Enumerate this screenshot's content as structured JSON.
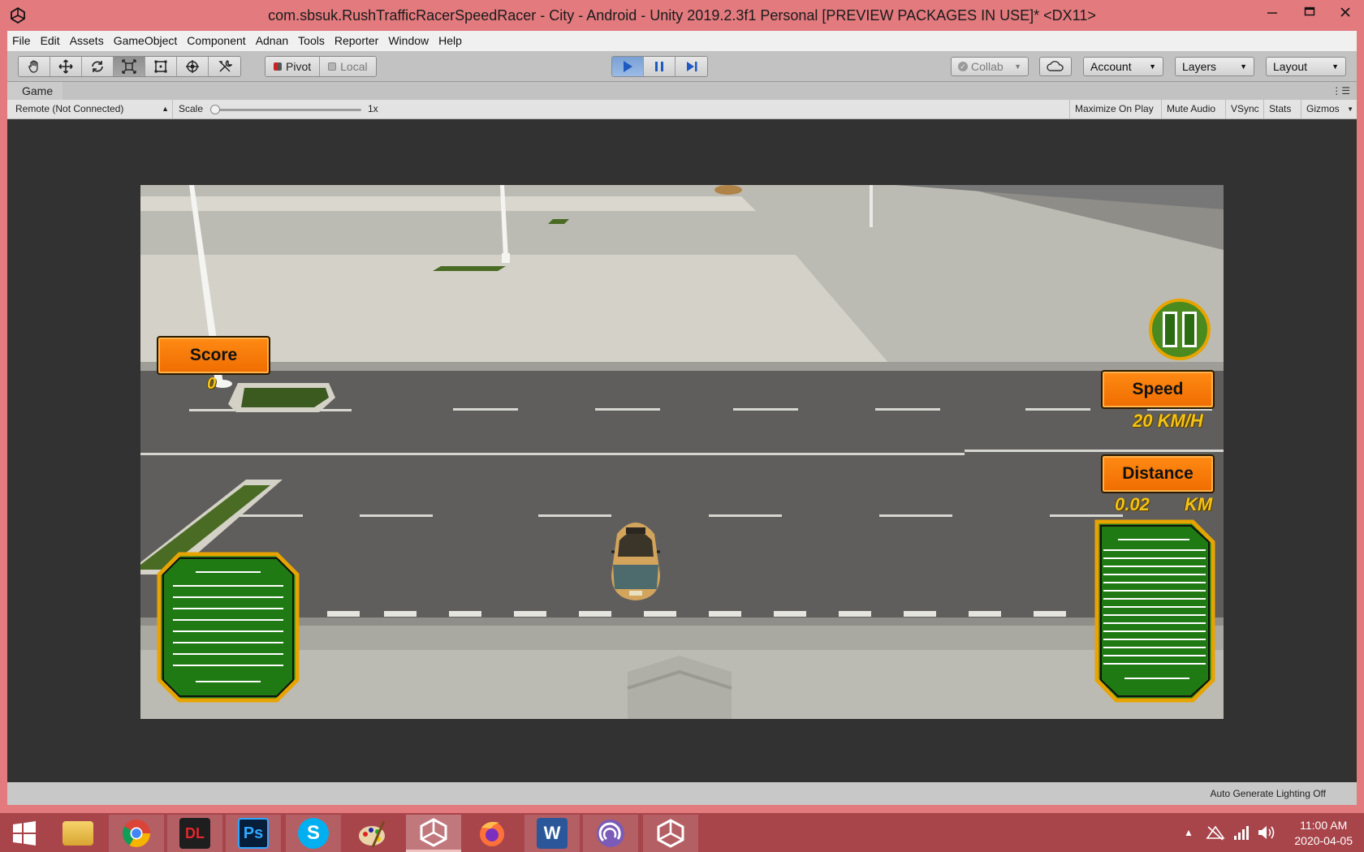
{
  "window": {
    "title": "com.sbsuk.RushTrafficRacerSpeedRacer - City - Android - Unity 2019.2.3f1 Personal [PREVIEW PACKAGES IN USE]* <DX11>",
    "controls": [
      "minimize-icon",
      "maximize-icon",
      "close-icon"
    ]
  },
  "menu": [
    "File",
    "Edit",
    "Assets",
    "GameObject",
    "Component",
    "Adnan",
    "Tools",
    "Reporter",
    "Window",
    "Help"
  ],
  "toolbar": {
    "transform_tools": [
      "hand-icon",
      "move-icon",
      "rotate-icon",
      "scale-icon",
      "rect-icon",
      "transform-icon",
      "custom-tool-icon"
    ],
    "pivot_label": "Pivot",
    "local_label": "Local",
    "collab_label": "Collab",
    "account_label": "Account",
    "layers_label": "Layers",
    "layout_label": "Layout",
    "accent": "#3d7ed6"
  },
  "game_tab": {
    "label": "Game",
    "remote": "Remote (Not Connected)",
    "scale_label": "Scale",
    "scale_value": "1x",
    "scale_level": 0,
    "buttons": [
      "Maximize On Play",
      "Mute Audio",
      "VSync",
      "Stats",
      "Gizmos"
    ]
  },
  "hud": {
    "score_label": "Score",
    "score_value": "0",
    "speed_label": "Speed",
    "speed_value": "20 KM/H",
    "distance_label": "Distance",
    "distance_value": "0.02",
    "distance_unit": "KM",
    "orange": "#f47b00",
    "green": "#1f7a14"
  },
  "status": {
    "text": "Auto Generate Lighting Off"
  },
  "taskbar": {
    "apps": [
      "file-explorer-icon",
      "chrome-icon",
      "downloader-icon",
      "photoshop-icon",
      "skype-icon",
      "paint-icon",
      "unity-icon",
      "firefox-icon",
      "word-icon",
      "bittorrent-icon",
      "unity-icon"
    ],
    "ps_label": "Ps",
    "skype_label": "S",
    "word_label": "W",
    "dl_label": "DL",
    "time": "11:00 AM",
    "date": "2020-04-05"
  }
}
